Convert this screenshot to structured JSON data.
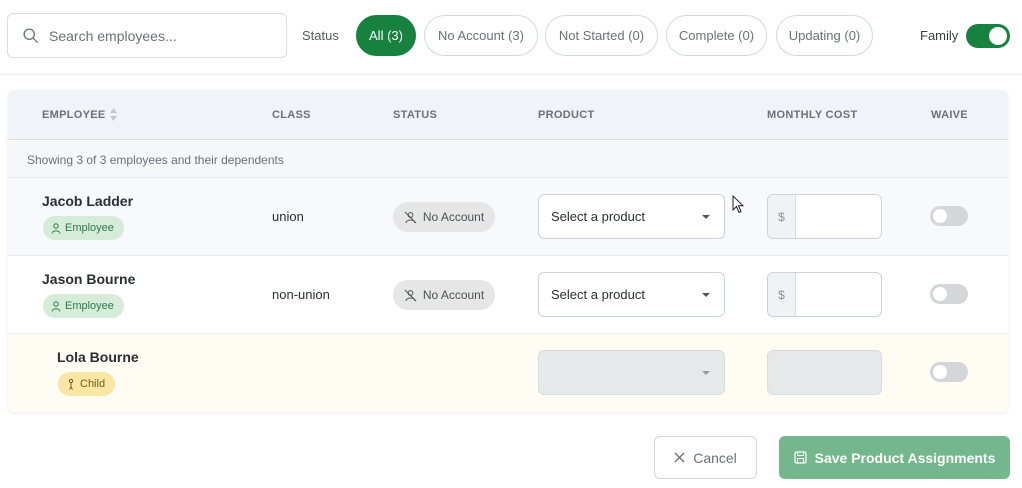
{
  "filters": {
    "search_placeholder": "Search employees...",
    "status_label": "Status",
    "pills": [
      {
        "label": "All (3)",
        "active": true
      },
      {
        "label": "No Account (3)",
        "active": false
      },
      {
        "label": "Not Started (0)",
        "active": false
      },
      {
        "label": "Complete (0)",
        "active": false
      },
      {
        "label": "Updating (0)",
        "active": false
      }
    ],
    "family_label": "Family",
    "family_on": true
  },
  "table": {
    "headers": {
      "employee": "EMPLOYEE",
      "class": "CLASS",
      "status": "STATUS",
      "product": "PRODUCT",
      "monthly_cost": "MONTHLY COST",
      "waive": "WAIVE"
    },
    "summary": "Showing 3 of 3 employees and their dependents",
    "rows": [
      {
        "name": "Jacob Ladder",
        "badge": "Employee",
        "class": "union",
        "status": "No Account",
        "product": "Select a product",
        "currency": "$",
        "waive": false
      },
      {
        "name": "Jason Bourne",
        "badge": "Employee",
        "class": "non-union",
        "status": "No Account",
        "product": "Select a product",
        "currency": "$",
        "waive": false
      },
      {
        "name": "Lola Bourne",
        "badge": "Child",
        "class": "",
        "status": "",
        "product": "",
        "currency": "",
        "waive": false
      }
    ]
  },
  "footer": {
    "cancel_label": "Cancel",
    "save_label": "Save Product Assignments"
  },
  "colors": {
    "accent": "#17813f",
    "save_disabled": "#74b78c",
    "employee_badge": "#d5ecd9",
    "child_badge": "#fbe6a6"
  }
}
